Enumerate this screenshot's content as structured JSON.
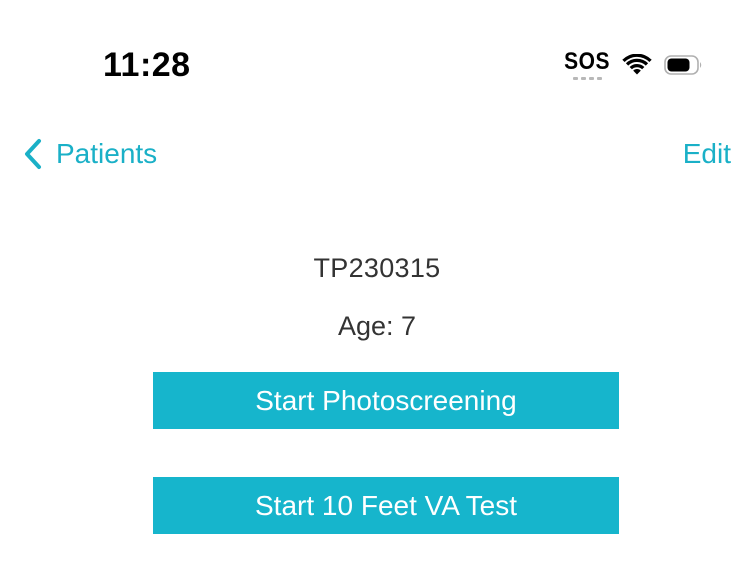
{
  "status_bar": {
    "time": "11:28",
    "sos_label": "SOS",
    "icons": [
      "wifi-icon",
      "battery-icon"
    ]
  },
  "nav": {
    "back_label": "Patients",
    "back_icon": "chevron-left-icon",
    "edit_label": "Edit"
  },
  "patient": {
    "id": "TP230315",
    "age": "Age: 7"
  },
  "actions": {
    "photoscreening_label": "Start Photoscreening",
    "va_test_label": "Start 10 Feet VA Test"
  },
  "colors": {
    "accent": "#1ab0c7",
    "button_bg": "#16b5cc",
    "button_text": "#ffffff",
    "body_text": "#333333"
  }
}
